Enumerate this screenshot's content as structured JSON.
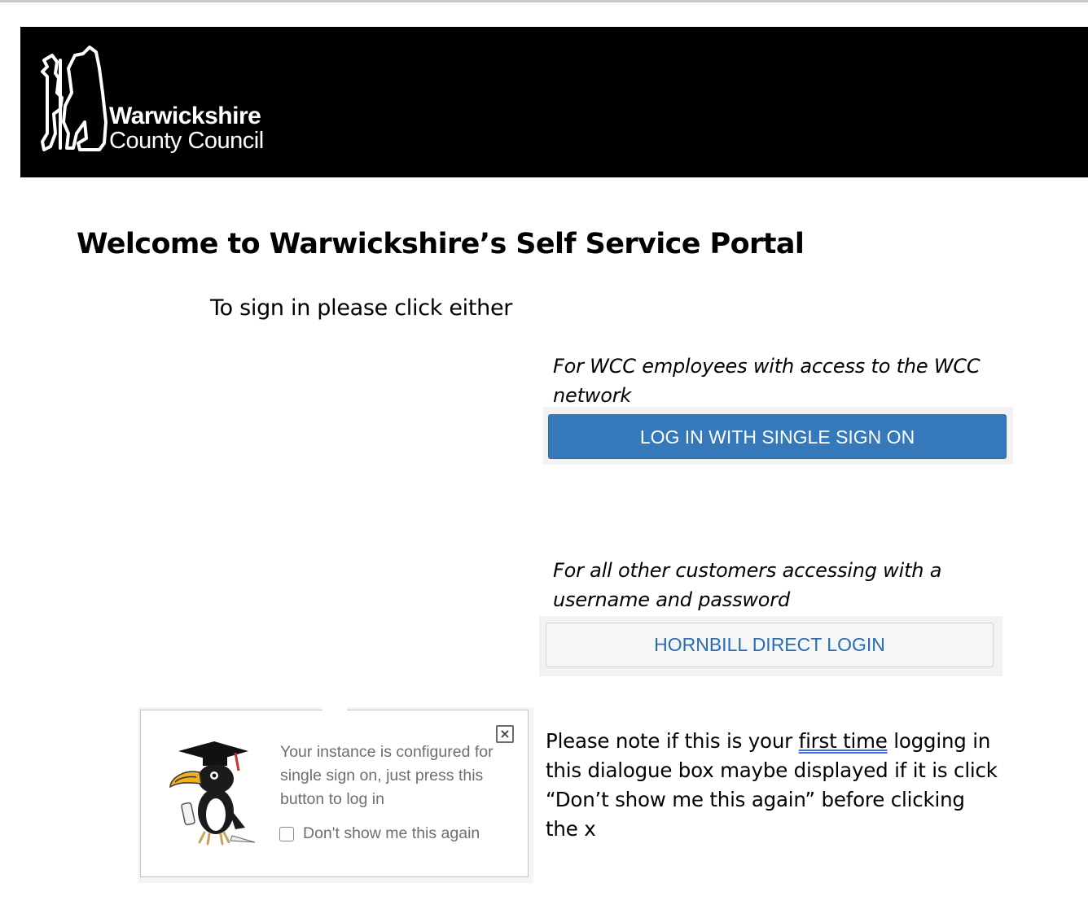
{
  "header": {
    "logo_line1": "Warwickshire",
    "logo_line2": "County Council"
  },
  "main": {
    "title": "Welcome to Warwickshire’s Self Service Portal",
    "intro": "To sign in please click either",
    "sso": {
      "caption": "For WCC employees with access to the WCC network",
      "button_label": "LOG IN WITH SINGLE SIGN ON"
    },
    "direct": {
      "caption": "For all other customers accessing with a username and password",
      "button_label": "HORNBILL DIRECT LOGIN"
    }
  },
  "dialog": {
    "message": "Your instance is configured for single sign on, just press this button to log in",
    "checkbox_label": "Don't show me this again",
    "checkbox_checked": false,
    "close_glyph": "×",
    "icons": [
      "close-icon",
      "hornbill-mascot-icon"
    ]
  },
  "note": {
    "before": "Please note if this is your ",
    "emphasis": "first time",
    "after": " logging in this dialogue box maybe displayed if it is click “Don’t show me this again” before clicking the x"
  },
  "colors": {
    "banner": "#000000",
    "sso_button": "#3579ba",
    "direct_button_text": "#2b6cae",
    "dialog_text": "#6e6e6e"
  }
}
